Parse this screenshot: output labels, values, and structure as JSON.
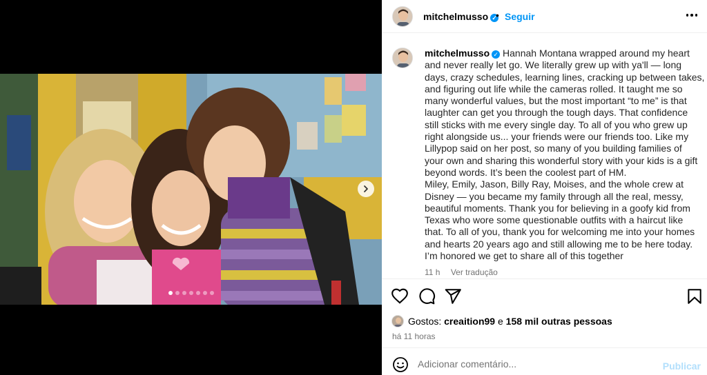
{
  "post": {
    "username": "mitchelmusso",
    "verified": true,
    "separator": "•",
    "follow_label": "Seguir",
    "more_icon": "more-horizontal-icon"
  },
  "media": {
    "slide_count": 7,
    "active_slide": 1,
    "next_icon": "chevron-right-icon"
  },
  "caption": {
    "username": "mitchelmusso",
    "lines": [
      "Hannah Montana wrapped around my heart",
      "and never really let go. We literally grew up with ya'll — long",
      "days, crazy schedules, learning lines, cracking up between takes,",
      "and figuring out life while the cameras rolled. It taught me so",
      "many wonderful values, but the most important “to me” is that",
      "laughter can get you through the tough days. That confidence",
      "still sticks with me every single day. To all of you who grew up",
      "right alongside us... your friends were our friends too. Like my",
      "Lillypop said on her post, so many of you building families of",
      "your own and sharing this wonderful story with your kids is a gift",
      "beyond words. It’s been the coolest part of HM.",
      "Miley, Emily, Jason, Billy Ray, Moises, and the whole crew at",
      "Disney — you became my family through all the real, messy,",
      "beautiful moments. Thank you for believing in a goofy kid from",
      "Texas who wore some questionable outfits with a haircut like",
      "that. To all of you, thank you for welcoming me into your homes",
      "and hearts 20 years ago and still allowing me to be here today.",
      "I’m honored we get to share all of this together"
    ],
    "time_ago": "11 h",
    "translate_label": "Ver tradução"
  },
  "actions": {
    "like_icon": "heart-icon",
    "comment_icon": "comment-icon",
    "share_icon": "send-icon",
    "save_icon": "bookmark-icon"
  },
  "likes": {
    "prefix": "Gostos:",
    "first_user": "creaition99",
    "conjunction": "e",
    "others": "158 mil outras pessoas"
  },
  "timestamp": "há 11 horas",
  "comment": {
    "emoji_icon": "emoji-icon",
    "placeholder": "Adicionar comentário...",
    "value": "",
    "publish_label": "Publicar"
  },
  "colors": {
    "accent": "#0095f6",
    "publish_disabled": "#b2dffc",
    "muted_text": "#737373",
    "divider": "#efefef"
  }
}
